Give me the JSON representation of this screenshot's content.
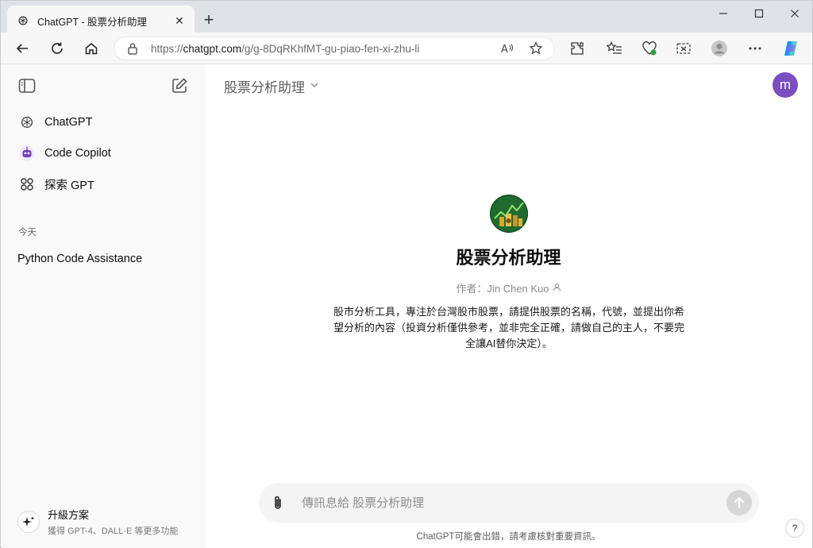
{
  "browser": {
    "tab_title": "ChatGPT - 股票分析助理",
    "tab_close": "✕",
    "new_tab": "+",
    "url_prefix": "https://",
    "url_host": "chatgpt.com",
    "url_path": "/g/g-8DqRKhfMT-gu-piao-fen-xi-zhu-li",
    "icons": [
      "back-icon",
      "refresh-icon",
      "home-icon",
      "lock-icon",
      "read-aloud-icon",
      "favorite-star-icon",
      "extensions-icon",
      "favorites-list-icon",
      "browser-essentials-icon",
      "screenshot-icon",
      "profile-icon",
      "more-icon",
      "copilot-icon"
    ]
  },
  "sidebar": {
    "items": [
      {
        "label": "ChatGPT",
        "icon": "openai-icon"
      },
      {
        "label": "Code Copilot",
        "icon": "robot-icon"
      },
      {
        "label": "探索 GPT",
        "icon": "grid-icon"
      }
    ],
    "section_today": "今天",
    "history": [
      "Python Code Assistance"
    ],
    "upgrade_title": "升級方案",
    "upgrade_sub": "獲得 GPT-4、DALL·E 等更多功能"
  },
  "main": {
    "model_name": "股票分析助理",
    "avatar_letter": "m",
    "gpt_name": "股票分析助理",
    "author": "作者：Jin Chen Kuo",
    "description": "股市分析工具，專注於台灣股市股票，請提供股票的名稱，代號，並提出你希望分析的內容（投資分析僅供參考，並非完全正確，請做自己的主人，不要完全讓AI替你決定）。",
    "composer_placeholder": "傳訊息給 股票分析助理",
    "disclaimer": "ChatGPT可能會出錯，請考慮核對重要資訊。",
    "help": "?"
  },
  "colors": {
    "avatar_bg": "#7b4ec0",
    "sidebar_bg": "#f9f9f9",
    "composer_bg": "#f4f4f4",
    "titlebar_bg": "#dfe3e8"
  }
}
